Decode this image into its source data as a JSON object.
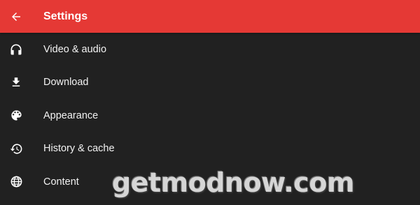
{
  "appbar": {
    "title": "Settings",
    "back_icon": "arrow-back-icon",
    "color": "#e53935"
  },
  "background_color": "#212121",
  "menu": {
    "items": [
      {
        "label": "Video & audio",
        "icon": "headphones-icon"
      },
      {
        "label": "Download",
        "icon": "download-icon"
      },
      {
        "label": "Appearance",
        "icon": "palette-icon"
      },
      {
        "label": "History & cache",
        "icon": "history-icon"
      },
      {
        "label": "Content",
        "icon": "globe-icon"
      }
    ]
  },
  "watermark": {
    "text": "getmodnow.com"
  }
}
